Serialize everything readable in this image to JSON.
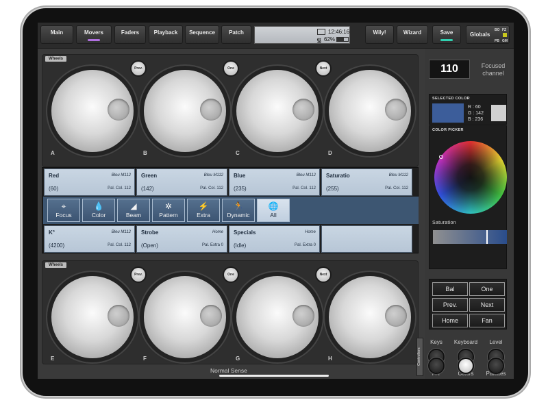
{
  "topbar": {
    "tabs": [
      {
        "label": "Main",
        "active": false
      },
      {
        "label": "Movers",
        "active": true
      },
      {
        "label": "Faders",
        "active": false
      },
      {
        "label": "Playback",
        "active": false
      },
      {
        "label": "Sequence",
        "active": false
      },
      {
        "label": "Patch",
        "active": false
      }
    ],
    "status": {
      "time": "12:46:16",
      "battery": "62%",
      "battery_level": 0.62
    },
    "right_tabs": [
      {
        "label": "Wily!"
      },
      {
        "label": "Wizard"
      },
      {
        "label": "Save"
      }
    ],
    "globals": {
      "label": "Globals",
      "bo": "BO",
      "fz": "FZ",
      "pb": "PB",
      "gm": "GM"
    },
    "colors": {
      "movers_led": "#b070e0",
      "save_led": "#30d0b0"
    }
  },
  "upper_wheels": {
    "tag": "Wheels",
    "buttons": [
      "Prev.",
      "One",
      "Next"
    ],
    "labels": [
      "A",
      "B",
      "C",
      "D"
    ]
  },
  "lower_wheels": {
    "tag": "Wheels",
    "buttons": [
      "Prev.",
      "One",
      "Next"
    ],
    "labels": [
      "E",
      "F",
      "G",
      "H"
    ]
  },
  "parameters": {
    "top_row": [
      {
        "name": "Red",
        "preset": "Bleu M112",
        "value": "(60)",
        "source": "Pal. Col. 112"
      },
      {
        "name": "Green",
        "preset": "Bleu M112",
        "value": "(142)",
        "source": "Pal. Col. 112"
      },
      {
        "name": "Blue",
        "preset": "Bleu M112",
        "value": "(235)",
        "source": "Pal. Col. 112"
      },
      {
        "name": "Saturatio",
        "preset": "Bleu M112",
        "value": "(255)",
        "source": "Pal. Col. 112"
      }
    ],
    "categories": [
      {
        "label": "Focus",
        "icon": "⌖",
        "selected": false
      },
      {
        "label": "Color",
        "icon": "💧",
        "selected": false
      },
      {
        "label": "Beam",
        "icon": "◢",
        "selected": false
      },
      {
        "label": "Pattern",
        "icon": "✲",
        "selected": false
      },
      {
        "label": "Extra",
        "icon": "⚡",
        "selected": false
      },
      {
        "label": "Dynamic",
        "icon": "🏃",
        "selected": false
      },
      {
        "label": "All",
        "icon": "🌐",
        "selected": true
      }
    ],
    "bottom_row": [
      {
        "name": "K°",
        "preset": "Bleu M112",
        "value": "(4200)",
        "source": "Pal. Col. 112"
      },
      {
        "name": "Strobe",
        "preset": "Home",
        "value": "(Open)",
        "source": "Pal. Extra 0"
      },
      {
        "name": "Specials",
        "preset": "Home",
        "value": "(Idle)",
        "source": "Pal. Extra 0"
      }
    ]
  },
  "bottom": {
    "mode_label": "Normal Sense",
    "controllers_label": "Controllers"
  },
  "side": {
    "channel": "110",
    "channel_label": "Focused channel",
    "selected_color": {
      "header": "SELECTED COLOR",
      "r": "R : 60",
      "g": "G : 142",
      "b": "B : 236",
      "swatch": "#3c5d9a",
      "swatch_alt": "#d0d0d0"
    },
    "color_picker": {
      "header": "COLOR PICKER"
    },
    "saturation": {
      "label": "Saturation",
      "level": 0.74
    },
    "selection_buttons": [
      "Bal",
      "One",
      "Prev.",
      "Next",
      "Home",
      "Fan"
    ],
    "controllers": [
      {
        "label": "Keys",
        "on": false
      },
      {
        "label": "Keyboard",
        "on": false
      },
      {
        "label": "Level",
        "on": false
      },
      {
        "label": "P/T",
        "on": false
      },
      {
        "label": "Colors",
        "on": true
      },
      {
        "label": "Palettes",
        "on": false
      }
    ]
  }
}
